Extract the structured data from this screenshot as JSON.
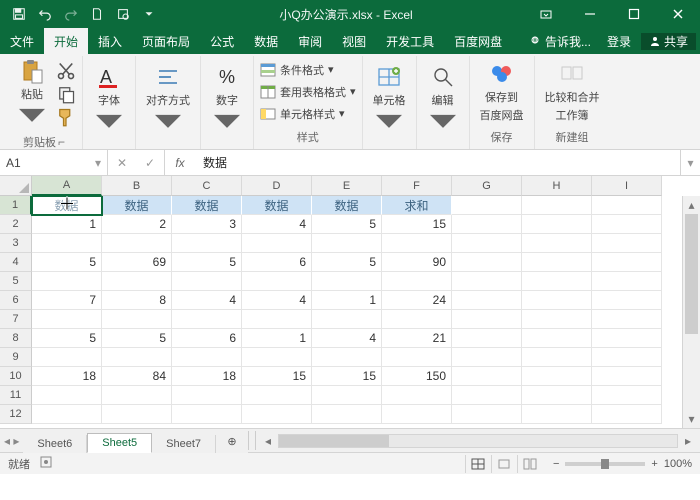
{
  "window": {
    "title": "小Q办公演示.xlsx - Excel"
  },
  "menu": {
    "file": "文件",
    "items": [
      "开始",
      "插入",
      "页面布局",
      "公式",
      "数据",
      "审阅",
      "视图",
      "开发工具",
      "百度网盘"
    ],
    "active": 0,
    "tell": "告诉我...",
    "login": "登录",
    "share": "共享"
  },
  "ribbon": {
    "clipboard": {
      "paste": "粘贴",
      "label": "剪贴板"
    },
    "font": {
      "label": "字体"
    },
    "align": {
      "label": "对齐方式"
    },
    "number": {
      "label": "数字"
    },
    "styles": {
      "cond": "条件格式",
      "tablefmt": "套用表格格式",
      "cellfmt": "单元格样式",
      "label": "样式"
    },
    "cells": {
      "label": "单元格"
    },
    "editing": {
      "label": "编辑"
    },
    "baidu": {
      "save": "保存到",
      "line2": "百度网盘",
      "label": "保存"
    },
    "newgroup": {
      "btn1": "比较和合并",
      "btn2": "工作簿",
      "label": "新建组"
    }
  },
  "namebox": "A1",
  "formula": "数据",
  "columns": [
    "A",
    "B",
    "C",
    "D",
    "E",
    "F",
    "G",
    "H",
    "I"
  ],
  "sel_col": 0,
  "sel_row": 0,
  "header_row": [
    "数据",
    "数据",
    "数据",
    "数据",
    "数据",
    "求和"
  ],
  "data_rows": [
    [
      "1",
      "2",
      "3",
      "4",
      "5",
      "15",
      "",
      "",
      ""
    ],
    [
      "",
      "",
      "",
      "",
      "",
      "",
      "",
      "",
      ""
    ],
    [
      "5",
      "69",
      "5",
      "6",
      "5",
      "90",
      "",
      "",
      ""
    ],
    [
      "",
      "",
      "",
      "",
      "",
      "",
      "",
      "",
      ""
    ],
    [
      "7",
      "8",
      "4",
      "4",
      "1",
      "24",
      "",
      "",
      ""
    ],
    [
      "",
      "",
      "",
      "",
      "",
      "",
      "",
      "",
      ""
    ],
    [
      "5",
      "5",
      "6",
      "1",
      "4",
      "21",
      "",
      "",
      ""
    ],
    [
      "",
      "",
      "",
      "",
      "",
      "",
      "",
      "",
      ""
    ],
    [
      "18",
      "84",
      "18",
      "15",
      "15",
      "150",
      "",
      "",
      ""
    ],
    [
      "",
      "",
      "",
      "",
      "",
      "",
      "",
      "",
      ""
    ],
    [
      "",
      "",
      "",
      "",
      "",
      "",
      "",
      "",
      ""
    ]
  ],
  "tabs": {
    "items": [
      "Sheet6",
      "Sheet5",
      "Sheet7"
    ],
    "active": 1
  },
  "status": {
    "ready": "就绪",
    "zoom": "100%"
  }
}
